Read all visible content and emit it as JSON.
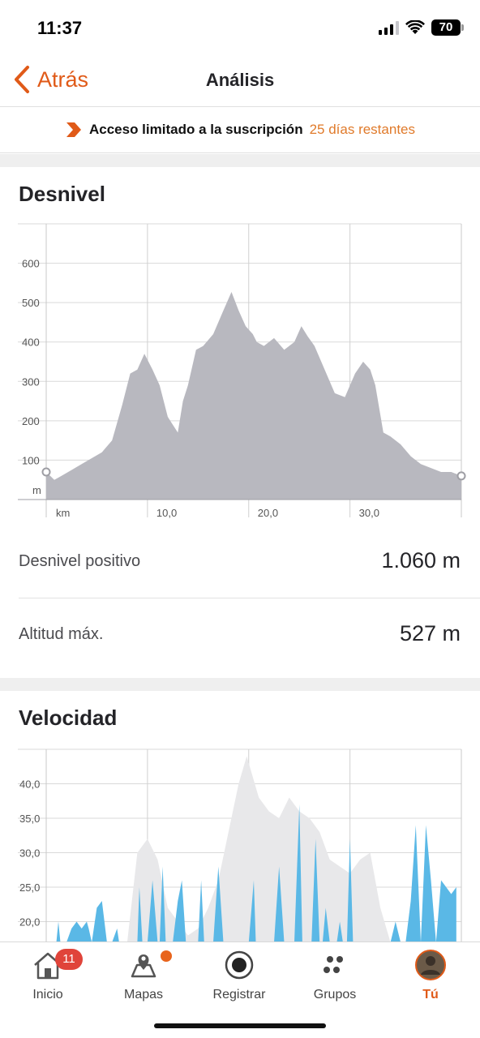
{
  "status_bar": {
    "time": "11:37",
    "battery": "70"
  },
  "nav": {
    "back_label": "Atrás",
    "title": "Análisis"
  },
  "subscription": {
    "text": "Acceso limitado a la suscripción",
    "days": "25 días restantes"
  },
  "elevation": {
    "title": "Desnivel",
    "stats": [
      {
        "label": "Desnivel positivo",
        "value": "1.060 m"
      },
      {
        "label": "Altitud máx.",
        "value": "527 m"
      }
    ]
  },
  "speed": {
    "title": "Velocidad"
  },
  "tabs": [
    {
      "label": "Inicio",
      "icon": "home-icon",
      "badge": "11"
    },
    {
      "label": "Mapas",
      "icon": "maps-icon"
    },
    {
      "label": "Registrar",
      "icon": "record-icon"
    },
    {
      "label": "Grupos",
      "icon": "groups-icon"
    },
    {
      "label": "Tú",
      "icon": "avatar-icon",
      "active": true
    }
  ],
  "colors": {
    "accent": "#e05a18",
    "elevation_fill": "#b8b8bf",
    "speed_fill": "#5ab8e6",
    "speed_bg_fill": "#e8e8ea",
    "badge": "#e0443a"
  },
  "chart_data": [
    {
      "type": "area",
      "title": "Desnivel",
      "xlabel": "km",
      "ylabel": "m",
      "xlim": [
        0,
        41
      ],
      "ylim": [
        0,
        700
      ],
      "xticks": [
        "10,0",
        "20,0",
        "30,0"
      ],
      "xtick_values": [
        10,
        20,
        30
      ],
      "yticks": [
        "100",
        "200",
        "300",
        "400",
        "500",
        "600"
      ],
      "ytick_values": [
        100,
        200,
        300,
        400,
        500,
        600
      ],
      "grid": true,
      "x": [
        0,
        0.8,
        1.5,
        2.5,
        3.5,
        4.5,
        5.5,
        6.5,
        7.5,
        8.3,
        9,
        9.7,
        10.5,
        11.2,
        12,
        12.5,
        13,
        13.5,
        14,
        14.8,
        15.5,
        16.5,
        17.5,
        18.3,
        19,
        19.7,
        20.4,
        20.8,
        21.5,
        22.5,
        23.5,
        24.5,
        25.2,
        25.8,
        26.5,
        27.5,
        28.5,
        29.5,
        30.5,
        31.3,
        32,
        32.5,
        33.3,
        34,
        35,
        36,
        37,
        38,
        39,
        40,
        41
      ],
      "y": [
        70,
        50,
        60,
        75,
        90,
        105,
        120,
        150,
        240,
        320,
        330,
        370,
        330,
        290,
        210,
        190,
        170,
        250,
        290,
        380,
        390,
        420,
        480,
        527,
        480,
        440,
        420,
        400,
        390,
        410,
        380,
        400,
        440,
        415,
        390,
        330,
        270,
        260,
        320,
        350,
        330,
        290,
        170,
        160,
        140,
        110,
        90,
        80,
        70,
        70,
        60
      ]
    },
    {
      "type": "area",
      "title": "Velocidad",
      "ylim": [
        17,
        45
      ],
      "yticks": [
        "20,0",
        "25,0",
        "30,0",
        "35,0",
        "40,0"
      ],
      "ytick_values": [
        20,
        25,
        30,
        35,
        40
      ],
      "grid": true,
      "series": [
        {
          "x": [
            0,
            8,
            9,
            10,
            11,
            12,
            13,
            14,
            15,
            16,
            17,
            18,
            19,
            19.8,
            21,
            22,
            23,
            24,
            25,
            26,
            27,
            28,
            29,
            30,
            31,
            32,
            33,
            34,
            41
          ],
          "values": [
            17,
            17,
            30,
            32,
            29,
            22,
            20,
            18,
            19,
            22,
            26,
            33,
            40,
            44,
            38,
            36,
            35,
            38,
            36,
            35,
            33,
            29,
            28,
            27,
            29,
            30,
            22,
            17,
            17
          ]
        },
        {
          "x": [
            0,
            1,
            1.2,
            1.4,
            2,
            2.5,
            3,
            3.5,
            4,
            4.2,
            4.5,
            5,
            5.5,
            6,
            6.5,
            7,
            7.2,
            7.6,
            8,
            8.5,
            9,
            9.2,
            9.5,
            9.8,
            10,
            10.5,
            11,
            11.2,
            11.5,
            11.8,
            12,
            12.5,
            13,
            13.4,
            13.8,
            14,
            14.2,
            14.5,
            15,
            15.3,
            15.6,
            16,
            16.5,
            17,
            17.5,
            18,
            18.5,
            19,
            19.5,
            20,
            20.5,
            20.7,
            21,
            21.5,
            22,
            22.5,
            23,
            23.5,
            24,
            24.5,
            25,
            25.3,
            25.8,
            26.2,
            26.6,
            27,
            27.3,
            27.6,
            28,
            28.3,
            28.7,
            29,
            29.3,
            29.7,
            30,
            30.3,
            30.7,
            31,
            31.5,
            32,
            32.5,
            33,
            33.5,
            34,
            34.5,
            35,
            35.5,
            36,
            36.5,
            37,
            37.5,
            38,
            38.5,
            39,
            39.5,
            40,
            40.5
          ],
          "values": [
            17,
            17,
            20,
            17,
            17,
            19,
            20,
            19,
            20,
            19,
            17,
            22,
            23,
            17,
            17,
            19,
            17,
            17,
            17,
            17,
            17,
            25,
            17,
            17,
            17,
            26,
            17,
            17,
            28,
            17,
            17,
            17,
            23,
            26,
            17,
            17,
            17,
            17,
            17,
            26,
            17,
            17,
            17,
            28,
            17,
            17,
            17,
            17,
            17,
            17,
            26,
            17,
            17,
            17,
            17,
            17,
            28,
            17,
            17,
            17,
            37,
            17,
            17,
            17,
            32,
            17,
            17,
            22,
            17,
            17,
            17,
            20,
            17,
            17,
            32,
            17,
            17,
            17,
            17,
            17,
            17,
            17,
            17,
            17,
            20,
            17,
            17,
            23,
            34,
            17,
            34,
            26,
            17,
            26,
            25,
            24,
            25
          ]
        }
      ]
    }
  ]
}
